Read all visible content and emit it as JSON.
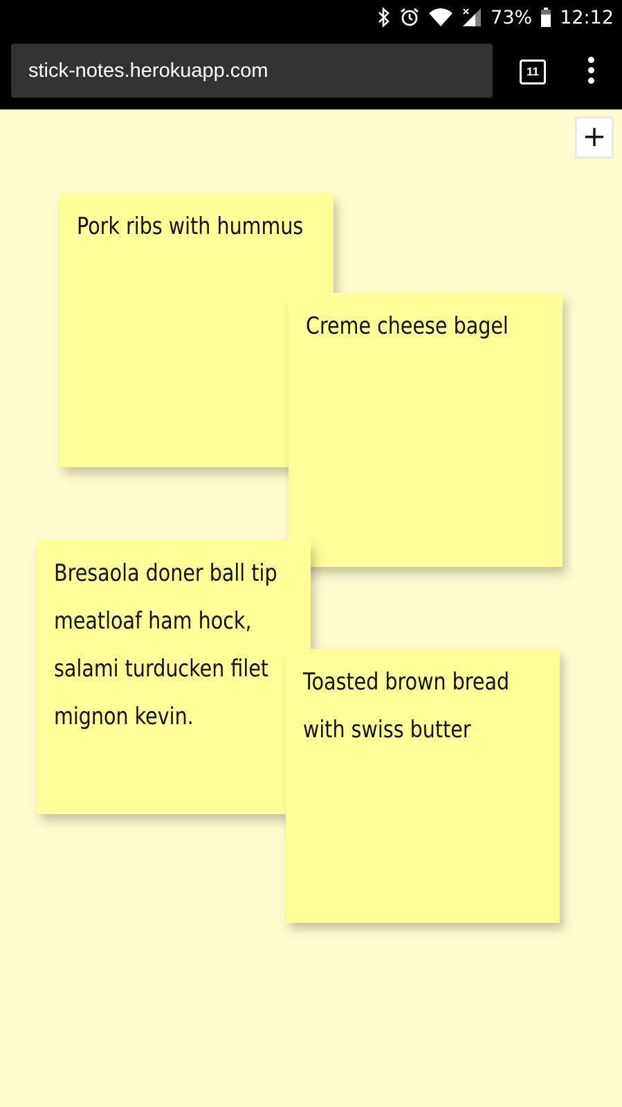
{
  "status_bar": {
    "battery_percent": "73%",
    "time": "12:12",
    "icons": [
      "bluetooth-icon",
      "alarm-icon",
      "wifi-icon",
      "cell-signal-icon",
      "battery-icon"
    ]
  },
  "browser": {
    "url": "stick-notes.herokuapp.com",
    "tab_count": "11"
  },
  "page": {
    "add_button_label": "+",
    "notes": [
      {
        "text": "Pork ribs with hummus"
      },
      {
        "text": "Creme cheese bagel"
      },
      {
        "text": "Bresaola doner ball tip meatloaf ham hock, salami turducken filet mignon kevin."
      },
      {
        "text": "Toasted brown bread with swiss butter"
      }
    ]
  },
  "colors": {
    "page_background": "#fffdd0",
    "note_background": "#ffff99",
    "browser_chrome": "#000000",
    "url_bar": "#333333"
  }
}
